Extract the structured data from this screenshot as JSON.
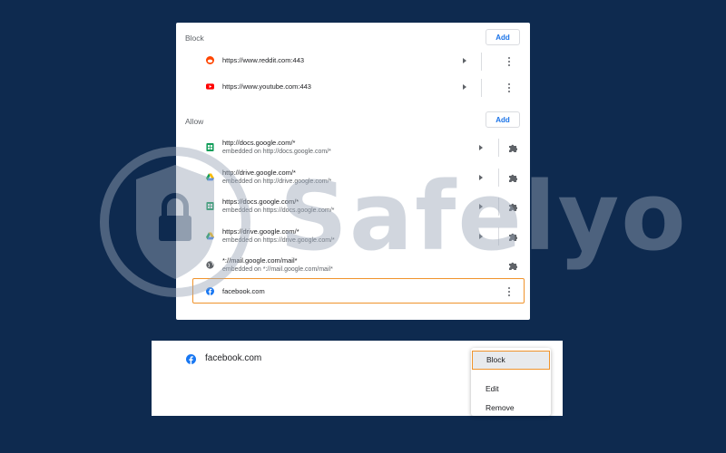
{
  "watermark": {
    "text": "Safelyo"
  },
  "block": {
    "title": "Block",
    "add_label": "Add",
    "items": [
      {
        "url": "https://www.reddit.com:443",
        "icon": "reddit-icon"
      },
      {
        "url": "https://www.youtube.com:443",
        "icon": "youtube-icon"
      }
    ]
  },
  "allow": {
    "title": "Allow",
    "add_label": "Add",
    "items": [
      {
        "url": "http://docs.google.com/*",
        "sub": "embedded on http://docs.google.com/*",
        "icon": "google-sheets-icon"
      },
      {
        "url": "http://drive.google.com/*",
        "sub": "embedded on http://drive.google.com/*",
        "icon": "google-drive-icon"
      },
      {
        "url": "https://docs.google.com/*",
        "sub": "embedded on https://docs.google.com/*",
        "icon": "google-sheets-icon"
      },
      {
        "url": "https://drive.google.com/*",
        "sub": "embedded on https://drive.google.com/*",
        "icon": "google-drive-icon"
      },
      {
        "url": "*://mail.google.com/mail*",
        "sub": "embedded on *://mail.google.com/mail*",
        "icon": "globe-icon"
      },
      {
        "url": "facebook.com",
        "icon": "facebook-icon"
      }
    ]
  },
  "context": {
    "site": "facebook.com",
    "menu": [
      "Block",
      "Edit",
      "Remove"
    ]
  },
  "colors": {
    "background": "#0e2a4f",
    "highlight": "#f0932b",
    "link_blue": "#1a73e8",
    "facebook": "#1877f2",
    "reddit": "#ff4500",
    "youtube": "#ff0000",
    "sheets": "#0f9d58"
  }
}
